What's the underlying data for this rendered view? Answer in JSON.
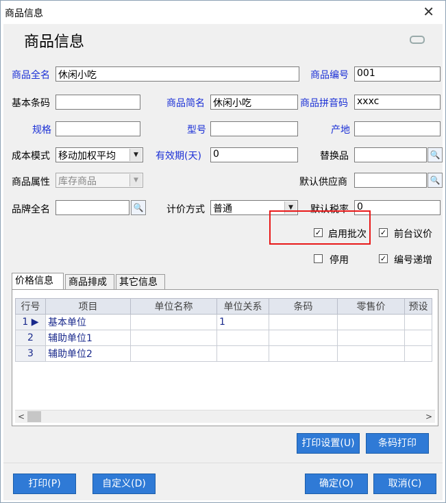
{
  "window": {
    "title": "商品信息",
    "close": "✕"
  },
  "header": {
    "title": "商品信息"
  },
  "form": {
    "full_name_label": "商品全名",
    "full_name_value": "休闲小吃",
    "code_label": "商品编号",
    "code_value": "001",
    "barcode_label": "基本条码",
    "barcode_value": "",
    "short_name_label": "商品简名",
    "short_name_value": "休闲小吃",
    "pinyin_label": "商品拼音码",
    "pinyin_value": "xxxc",
    "spec_label": "规格",
    "spec_value": "",
    "model_label": "型号",
    "model_value": "",
    "origin_label": "产地",
    "origin_value": "",
    "cost_mode_label": "成本模式",
    "cost_mode_value": "移动加权平均",
    "validity_label": "有效期(天)",
    "validity_value": "0",
    "substitute_label": "替换品",
    "substitute_value": "",
    "attr_label": "商品属性",
    "attr_value": "库存商品",
    "supplier_label": "默认供应商",
    "supplier_value": "",
    "brand_label": "品牌全名",
    "brand_value": "",
    "pricing_label": "计价方式",
    "pricing_value": "普通",
    "tax_label": "默认税率",
    "tax_value": "0"
  },
  "checks": {
    "batch": {
      "label": "启用批次",
      "checked": "✓"
    },
    "negotiate": {
      "label": "前台议价",
      "checked": "✓"
    },
    "disable": {
      "label": "停用",
      "checked": ""
    },
    "auto_inc": {
      "label": "编号递增",
      "checked": "✓"
    }
  },
  "tabs": [
    "价格信息",
    "商品排成",
    "其它信息"
  ],
  "grid": {
    "columns": [
      "行号",
      "项目",
      "单位名称",
      "单位关系",
      "条码",
      "零售价",
      "预设"
    ],
    "rows": [
      {
        "num": "1",
        "item": "基本单位",
        "unit": "",
        "rel": "1",
        "barcode": "",
        "price": "",
        "preset": ""
      },
      {
        "num": "2",
        "item": "辅助单位1",
        "unit": "",
        "rel": "",
        "barcode": "",
        "price": "",
        "preset": ""
      },
      {
        "num": "3",
        "item": "辅助单位2",
        "unit": "",
        "rel": "",
        "barcode": "",
        "price": "",
        "preset": ""
      }
    ]
  },
  "buttons": {
    "print_setup": "打印设置(U)",
    "barcode_print": "条码打印",
    "print": "打印(P)",
    "custom": "自定义(D)",
    "ok": "确定(O)",
    "cancel": "取消(C)"
  },
  "colors": {
    "accent": "#2f7ad6",
    "label_blue": "#1a2fd6",
    "highlight": "#e81818"
  },
  "icons": {
    "search": "magnifier-icon",
    "dropdown": "chevron-down-icon",
    "link": "link-icon",
    "row_pointer": "triangle-right-icon"
  }
}
